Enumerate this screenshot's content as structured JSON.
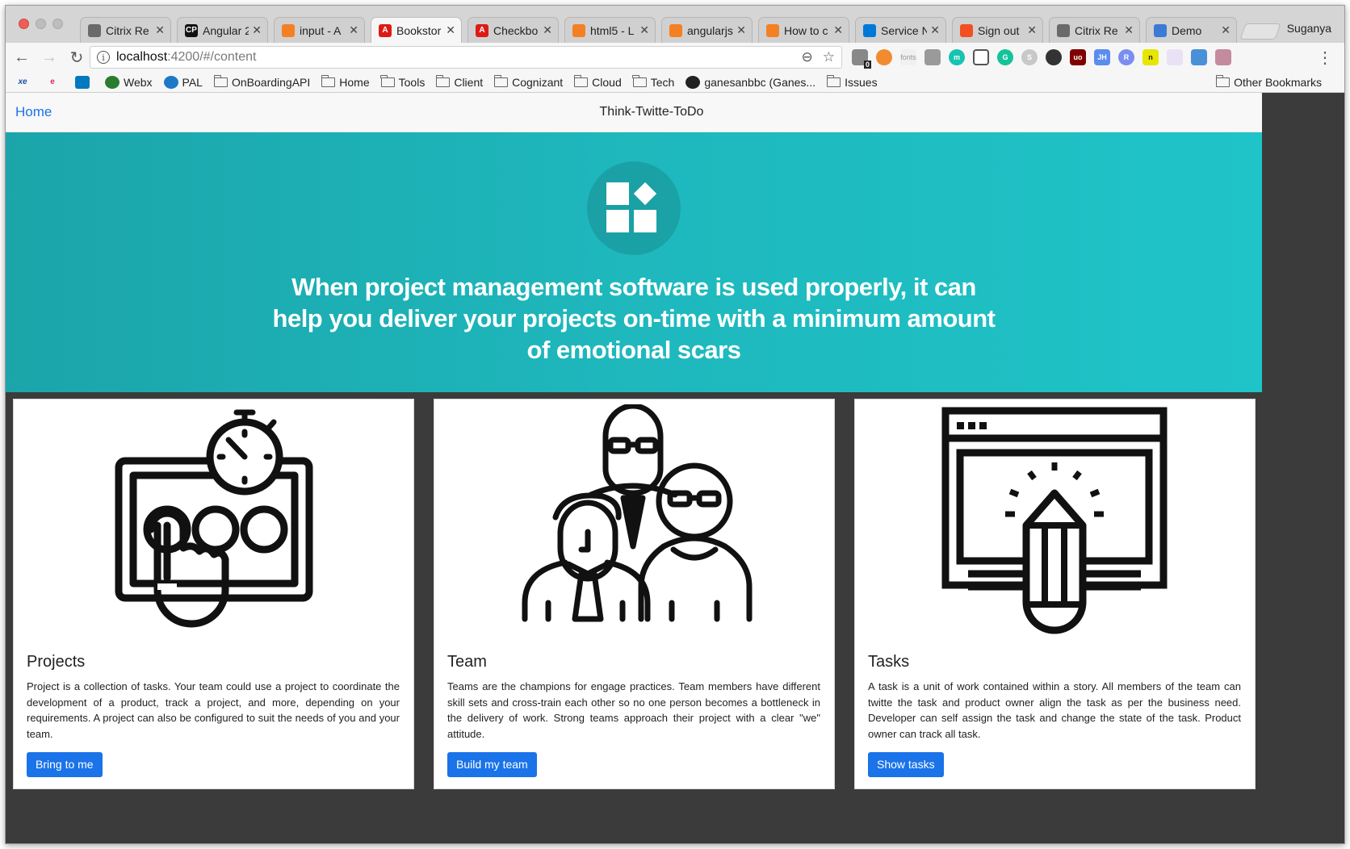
{
  "browser": {
    "tabs": [
      {
        "title": "Citrix Re",
        "favicon": "citrix-icon",
        "color": "#6a6a6a",
        "active": false
      },
      {
        "title": "Angular 2",
        "favicon": "codepen-icon",
        "color": "#111111",
        "active": false
      },
      {
        "title": "input - A",
        "favicon": "stackoverflow-icon",
        "color": "#f48024",
        "active": false
      },
      {
        "title": "Bookstor",
        "favicon": "angular-icon",
        "color": "#dd1b16",
        "active": true
      },
      {
        "title": "Checkbo",
        "favicon": "angular-icon",
        "color": "#dd1b16",
        "active": false
      },
      {
        "title": "html5 - L",
        "favicon": "stackoverflow-icon",
        "color": "#f48024",
        "active": false
      },
      {
        "title": "angularjs",
        "favicon": "stackoverflow-icon",
        "color": "#f48024",
        "active": false
      },
      {
        "title": "How to c",
        "favicon": "stackoverflow-icon",
        "color": "#f48024",
        "active": false
      },
      {
        "title": "Service N",
        "favicon": "windows-icon",
        "color": "#0078d7",
        "active": false
      },
      {
        "title": "Sign out",
        "favicon": "microsoft-icon",
        "color": "#f25022",
        "active": false
      },
      {
        "title": "Citrix Re",
        "favicon": "citrix-icon",
        "color": "#6a6a6a",
        "active": false
      },
      {
        "title": "Demo",
        "favicon": "monitor-icon",
        "color": "#3a7bd5",
        "active": false
      }
    ],
    "profile_name": "Suganya",
    "url_host": "localhost",
    "url_path": ":4200/#/content",
    "bookmarks": [
      {
        "label": "",
        "icon": "xe-icon"
      },
      {
        "label": "",
        "icon": "edge-icon"
      },
      {
        "label": "",
        "icon": "trello-icon"
      },
      {
        "label": "Webx",
        "icon": "webex-icon"
      },
      {
        "label": "PAL",
        "icon": "globe-icon"
      },
      {
        "label": "OnBoardingAPI",
        "icon": "folder-icon"
      },
      {
        "label": "Home",
        "icon": "folder-icon"
      },
      {
        "label": "Tools",
        "icon": "folder-icon"
      },
      {
        "label": "Client",
        "icon": "folder-icon"
      },
      {
        "label": "Cognizant",
        "icon": "folder-icon"
      },
      {
        "label": "Cloud",
        "icon": "folder-icon"
      },
      {
        "label": "Tech",
        "icon": "folder-icon"
      },
      {
        "label": "ganesanbbc (Ganes...",
        "icon": "github-icon"
      },
      {
        "label": "Issues",
        "icon": "folder-icon"
      }
    ],
    "other_bookmarks": "Other Bookmarks",
    "extension_badge": "0",
    "extension_fonts_label": "fonts"
  },
  "app": {
    "nav_home": "Home",
    "brand": "Think-Twitte-ToDo",
    "hero_text": "When project management software is used properly, it can help you deliver your projects on-time with a minimum amount of emotional scars",
    "accent_color": "#1a73e8",
    "hero_color": "#1eb8bd"
  },
  "cards": [
    {
      "title": "Projects",
      "icon": "projects-stopwatch-icon",
      "text": "Project is a collection of tasks. Your team could use a project to coordinate the development of a product, track a project, and more, depending on your requirements. A project can also be configured to suit the needs of you and your team.",
      "button": "Bring to me"
    },
    {
      "title": "Team",
      "icon": "team-people-icon",
      "text": "Teams are the champions for engage practices. Team members have different skill sets and cross-train each other so no one person becomes a bottleneck in the delivery of work. Strong teams approach their project with a clear \"we\" attitude.",
      "button": "Build my team"
    },
    {
      "title": "Tasks",
      "icon": "tasks-pencil-icon",
      "text": "A task is a unit of work contained within a story. All members of the team can twitte the task and product owner align the task as per the business need. Developer can self assign the task and change the state of the task. Product owner can track all task.",
      "button": "Show tasks"
    }
  ]
}
